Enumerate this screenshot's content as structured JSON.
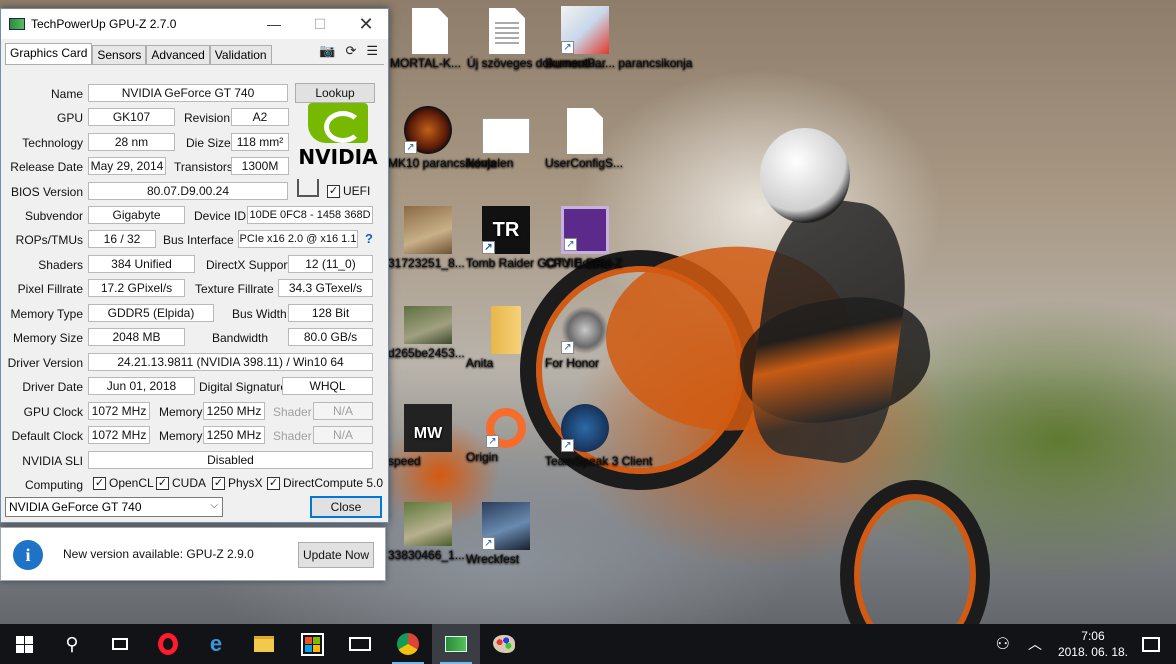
{
  "window": {
    "title": "TechPowerUp GPU-Z 2.7.0",
    "tabs": [
      "Graphics Card",
      "Sensors",
      "Advanced",
      "Validation"
    ],
    "active_tab": "Graphics Card"
  },
  "card": {
    "name_label": "Name",
    "name": "NVIDIA GeForce GT 740",
    "lookup": "Lookup",
    "gpu_label": "GPU",
    "gpu": "GK107",
    "revision_label": "Revision",
    "revision": "A2",
    "tech_label": "Technology",
    "tech": "28 nm",
    "die_label": "Die Size",
    "die": "118 mm²",
    "release_label": "Release Date",
    "release": "May 29, 2014",
    "transistors_label": "Transistors",
    "transistors": "1300M",
    "bios_label": "BIOS Version",
    "bios": "80.07.D9.00.24",
    "uefi": "UEFI",
    "subvendor_label": "Subvendor",
    "subvendor": "Gigabyte",
    "deviceid_label": "Device ID",
    "deviceid": "10DE 0FC8 - 1458 368D",
    "rops_label": "ROPs/TMUs",
    "rops": "16 / 32",
    "bus_label": "Bus Interface",
    "bus": "PCIe x16 2.0 @ x16 1.1",
    "help": "?",
    "shaders_label": "Shaders",
    "shaders": "384 Unified",
    "directx_label": "DirectX Support",
    "directx": "12 (11_0)",
    "pixel_label": "Pixel Fillrate",
    "pixel": "17.2 GPixel/s",
    "texture_label": "Texture Fillrate",
    "texture": "34.3 GTexel/s",
    "memtype_label": "Memory Type",
    "memtype": "GDDR5 (Elpida)",
    "buswidth_label": "Bus Width",
    "buswidth": "128 Bit",
    "memsize_label": "Memory Size",
    "memsize": "2048 MB",
    "bandwidth_label": "Bandwidth",
    "bandwidth": "80.0 GB/s",
    "driver_label": "Driver Version",
    "driver": "24.21.13.9811 (NVIDIA 398.11) / Win10 64",
    "driverdate_label": "Driver Date",
    "driverdate": "Jun 01, 2018",
    "sig_label": "Digital Signature",
    "sig": "WHQL",
    "gpuclock_label": "GPU Clock",
    "gpuclock": "1072 MHz",
    "memory_label": "Memory",
    "memclock": "1250 MHz",
    "shader_label": "Shader",
    "shader": "N/A",
    "defclock_label": "Default Clock",
    "defclock": "1072 MHz",
    "defmem": "1250 MHz",
    "defshader": "N/A",
    "sli_label": "NVIDIA SLI",
    "sli": "Disabled",
    "computing_label": "Computing",
    "opencl": "OpenCL",
    "cuda": "CUDA",
    "physx": "PhysX",
    "dc": "DirectCompute 5.0",
    "vendor_logo": "NVIDIA"
  },
  "footer": {
    "selected_gpu": "NVIDIA GeForce GT 740",
    "close": "Close"
  },
  "notification": {
    "message": "New version available: GPU-Z 2.9.0",
    "update": "Update Now"
  },
  "desktop": {
    "icons": [
      {
        "label": "MORTAL-K..."
      },
      {
        "label": "Új szöveges dokumentu..."
      },
      {
        "label": "BurnoutPar... parancsikonja"
      },
      {
        "label": "MK10 parancsikonja"
      },
      {
        "label": "Névtelen"
      },
      {
        "label": "UserConfigS..."
      },
      {
        "label": "31723251_8..."
      },
      {
        "label": "Tomb Raider GOTY Edition"
      },
      {
        "label": "CPUID CPU-Z"
      },
      {
        "label": "d265be2453..."
      },
      {
        "label": "Anita"
      },
      {
        "label": "For Honor"
      },
      {
        "label": "speed"
      },
      {
        "label": "Origin"
      },
      {
        "label": "TeamSpeak 3 Client"
      },
      {
        "label": "33830466_1..."
      },
      {
        "label": "Wreckfest"
      }
    ]
  },
  "taskbar": {
    "time": "7:06",
    "date": "2018. 06. 18."
  },
  "colors": {
    "nvidia_green": "#76b900",
    "accent": "#0078d7",
    "taskbar": "#111317"
  }
}
